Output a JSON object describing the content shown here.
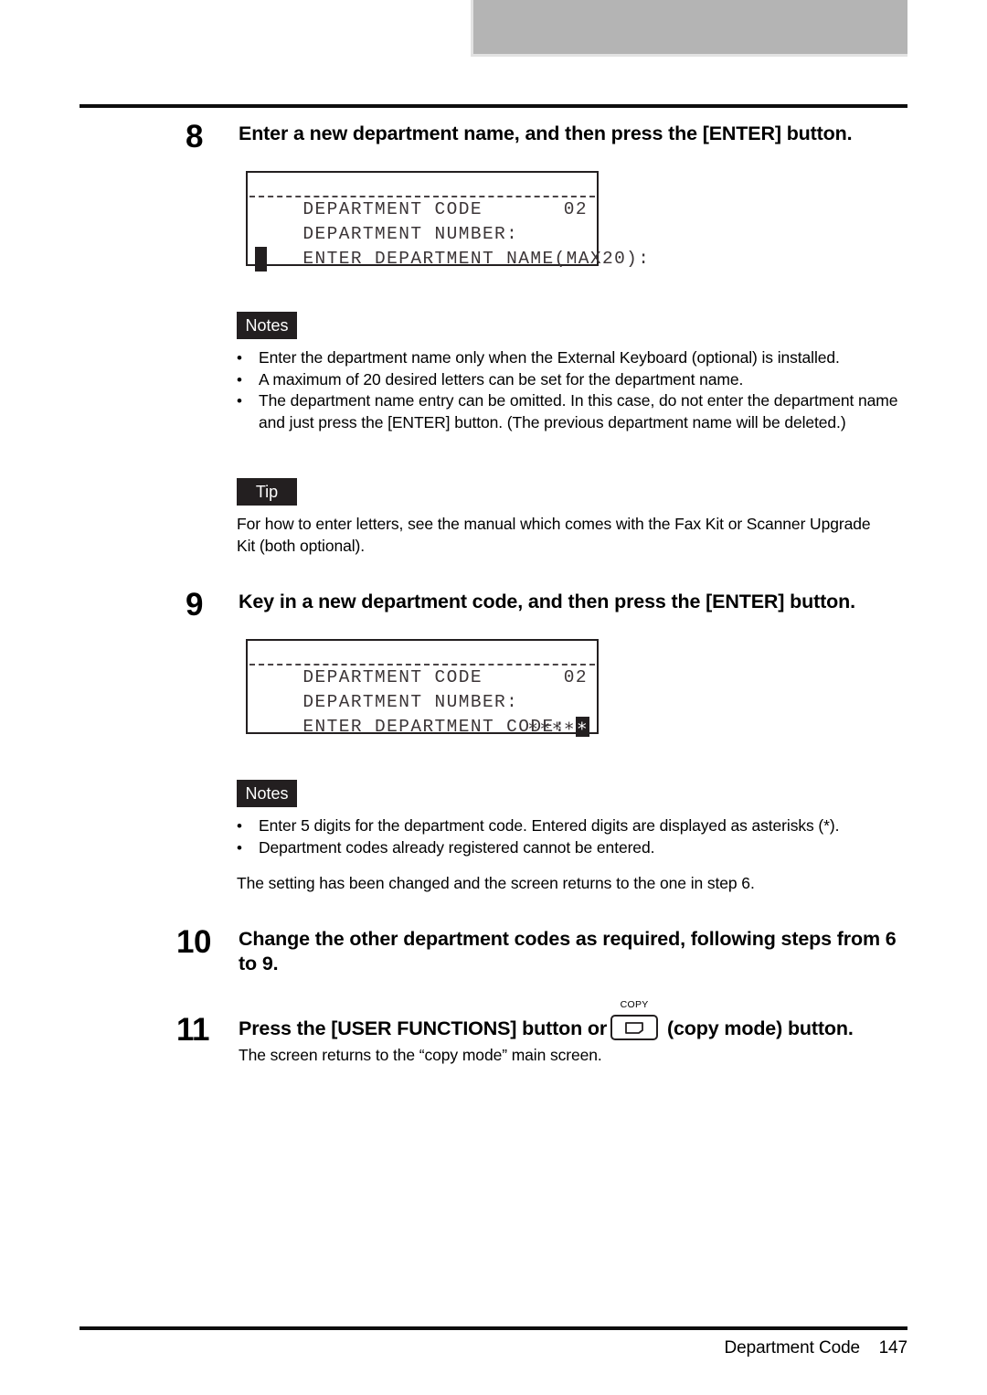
{
  "page": {
    "footer_section": "Department Code",
    "footer_page_number": "147"
  },
  "steps": [
    {
      "number": "8",
      "title": "Enter a new department name, and then press the [ENTER] button."
    },
    {
      "number": "9",
      "title": "Key in a new department code, and then press the [ENTER] button."
    },
    {
      "number": "10",
      "title": "Change the other department codes as required, following steps from 6 to 9."
    },
    {
      "number": "11",
      "title_before_icon": "Press the [USER FUNCTIONS] button or",
      "icon_label": "COPY",
      "icon_name": "copy-mode-button-icon",
      "title_after_icon": "(copy mode) button.",
      "subtext": "The screen returns to the “copy mode” main screen."
    }
  ],
  "lcd_screen_1": {
    "line1": "DEPARTMENT CODE",
    "line2_label": "DEPARTMENT NUMBER:",
    "line2_value": "02",
    "line3": "ENTER DEPARTMENT NAME(MAX20):",
    "line4_cursor": ""
  },
  "lcd_screen_2": {
    "line1": "DEPARTMENT CODE",
    "line2_label": "DEPARTMENT NUMBER:",
    "line2_value": "02",
    "line3": "ENTER DEPARTMENT CODE:",
    "line4_stars": "∗∗∗∗",
    "line4_cursor_star": "∗"
  },
  "notes_1": {
    "badge": "Notes",
    "items": [
      "Enter the department name only when the External Keyboard (optional) is installed.",
      "A maximum of 20 desired letters can be set for the department name.",
      "The department name entry can be omitted. In this case, do not enter the department name and just press the [ENTER] button. (The previous department name will be deleted.)"
    ],
    "bullet_glyph": "•"
  },
  "tip_1": {
    "badge": "Tip",
    "text": "For how to enter letters, see the manual which comes with the Fax Kit or Scanner Upgrade Kit (both optional)."
  },
  "notes_2": {
    "badge": "Notes",
    "items": [
      "Enter 5 digits for the department code. Entered digits are displayed as asterisks (*).",
      "Department codes already registered cannot be entered."
    ],
    "bullet_glyph": "•",
    "after_text": "The setting has been changed and the screen returns to the one in step 6."
  },
  "colors": {
    "badge_background": "#231f20",
    "header_band": "#b4b4b4",
    "rule": "#0d0d0d",
    "lcd_text": "#3b3537"
  }
}
